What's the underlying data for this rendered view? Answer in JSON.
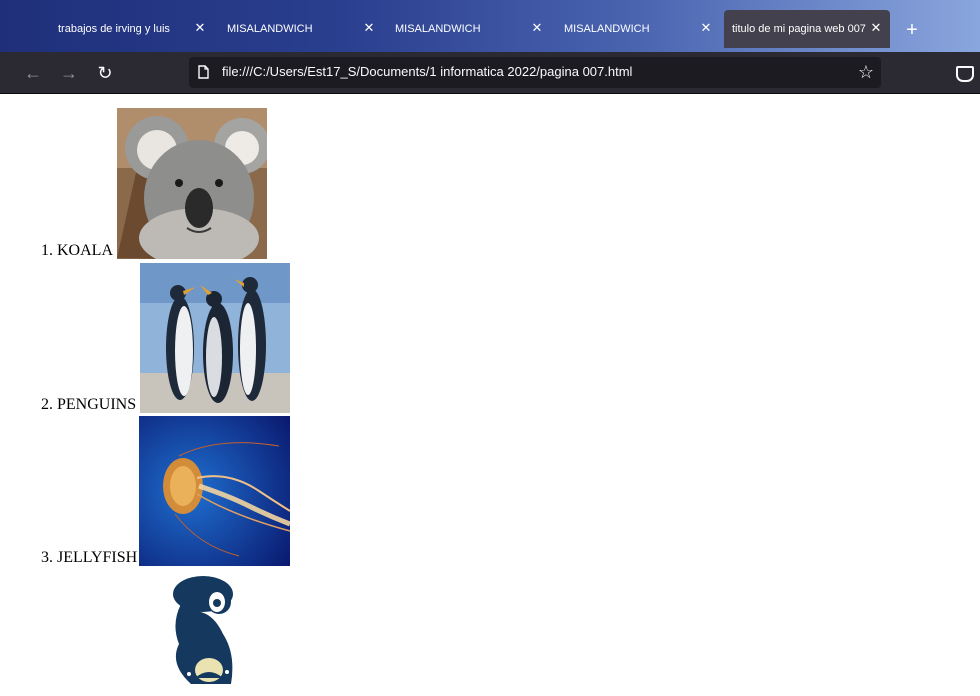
{
  "tabs": [
    {
      "label": "trabajos de irving y luis"
    },
    {
      "label": "MISALANDWICH"
    },
    {
      "label": "MISALANDWICH"
    },
    {
      "label": "MISALANDWICH"
    },
    {
      "label": "titulo de mi pagina web 007",
      "active": true
    }
  ],
  "toolbar": {
    "url": "file:///C:/Users/Est17_S/Documents/1 informatica 2022/pagina 007.html"
  },
  "page": {
    "items": [
      {
        "label": "1. KOALA",
        "image": "koala-photo"
      },
      {
        "label": "2. PENGUINS",
        "image": "penguins-photo"
      },
      {
        "label": "3. JELLYFISH",
        "image": "jellyfish-photo"
      },
      {
        "label": "",
        "image": "stitch-silhouette"
      }
    ]
  },
  "colors": {
    "tabstrip_start": "#1f2f7a",
    "tabstrip_end": "#8aa6de",
    "toolbar": "#2b2a33",
    "urlbar": "#1c1b22",
    "active_tab": "#42414d"
  }
}
